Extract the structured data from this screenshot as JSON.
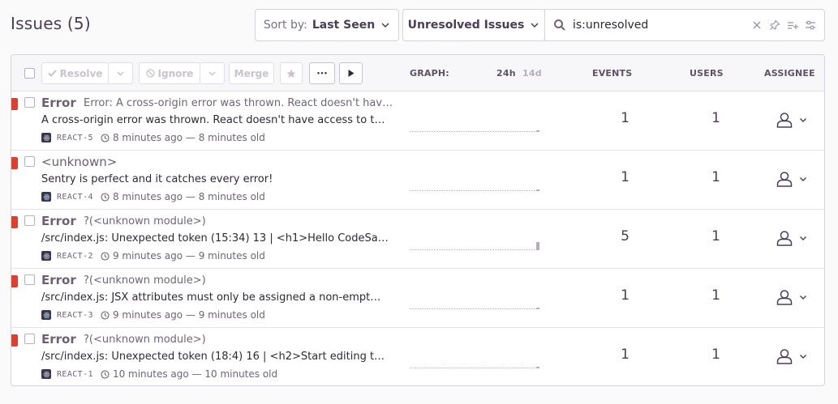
{
  "page": {
    "title": "Issues (5)"
  },
  "toolbar": {
    "sort_label": "Sort by:",
    "sort_value": "Last Seen",
    "filter_value": "Unresolved Issues",
    "search_value": "is:unresolved"
  },
  "actions": {
    "resolve": "Resolve",
    "ignore": "Ignore",
    "merge": "Merge",
    "more": "•••"
  },
  "columns": {
    "graph": "GRAPH:",
    "period_24h": "24h",
    "period_14d": "14d",
    "events": "EVENTS",
    "users": "USERS",
    "assignee": "ASSIGNEE"
  },
  "colors": {
    "level_error": "#e03e2f",
    "accent": "#4a3e56"
  },
  "issues": [
    {
      "title": "Error",
      "subtitle": "Error: A cross-origin error was thrown. React doesn't hav…",
      "message": "A cross-origin error was thrown. React doesn't have access to th…",
      "short_id": "REACT-5",
      "time": "8 minutes ago — 8 minutes old",
      "events": "1",
      "users": "1",
      "graph_last": 1
    },
    {
      "title": "<unknown>",
      "subtitle": "",
      "message": "Sentry is perfect and it catches every error!",
      "short_id": "REACT-4",
      "time": "8 minutes ago — 8 minutes old",
      "events": "1",
      "users": "1",
      "graph_last": 1
    },
    {
      "title": "Error",
      "subtitle": "?(<unknown module>)",
      "message": "/src/index.js: Unexpected token (15:34) 13 | <h1>Hello CodeSand…",
      "short_id": "REACT-2",
      "time": "9 minutes ago — 9 minutes old",
      "events": "5",
      "users": "1",
      "graph_last": 5
    },
    {
      "title": "Error",
      "subtitle": "?(<unknown module>)",
      "message": "/src/index.js: JSX attributes must only be assigned a non-empt…",
      "short_id": "REACT-3",
      "time": "9 minutes ago — 9 minutes old",
      "events": "1",
      "users": "1",
      "graph_last": 1
    },
    {
      "title": "Error",
      "subtitle": "?(<unknown module>)",
      "message": "/src/index.js: Unexpected token (18:4) 16 | <h2>Start editing to s…",
      "short_id": "REACT-1",
      "time": "10 minutes ago — 10 minutes old",
      "events": "1",
      "users": "1",
      "graph_last": 1
    }
  ]
}
